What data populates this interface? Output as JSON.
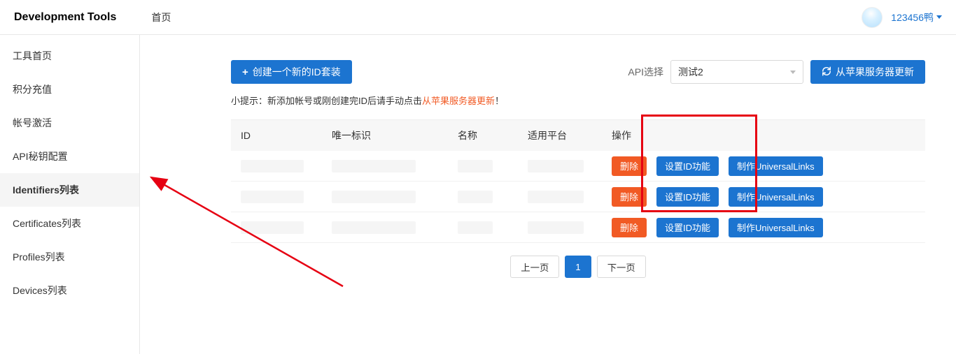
{
  "header": {
    "brand": "Development Tools",
    "home": "首页",
    "username": "123456鸭"
  },
  "sidebar": {
    "items": [
      {
        "label": "工具首页"
      },
      {
        "label": "积分充值"
      },
      {
        "label": "帐号激活"
      },
      {
        "label": "API秘钥配置"
      },
      {
        "label": "Identifiers列表",
        "active": true
      },
      {
        "label": "Certificates列表"
      },
      {
        "label": "Profiles列表"
      },
      {
        "label": "Devices列表"
      }
    ]
  },
  "toolbar": {
    "create_label": "创建一个新的ID套装",
    "api_label": "API选择",
    "api_selected": "测试2",
    "refresh_label": "从苹果服务器更新"
  },
  "hint": {
    "prefix": "小提示：新添加帐号或刚创建完ID后请手动点击",
    "link": "从苹果服务器更新",
    "suffix": "！"
  },
  "table": {
    "headers": {
      "id": "ID",
      "uid": "唯一标识",
      "name": "名称",
      "platform": "适用平台",
      "operation": "操作"
    },
    "ops": {
      "delete": "删除",
      "set_id": "设置ID功能",
      "make_ul": "制作UniversalLinks"
    },
    "rows": [
      {},
      {},
      {}
    ]
  },
  "pagination": {
    "prev": "上一页",
    "current": "1",
    "next": "下一页"
  }
}
